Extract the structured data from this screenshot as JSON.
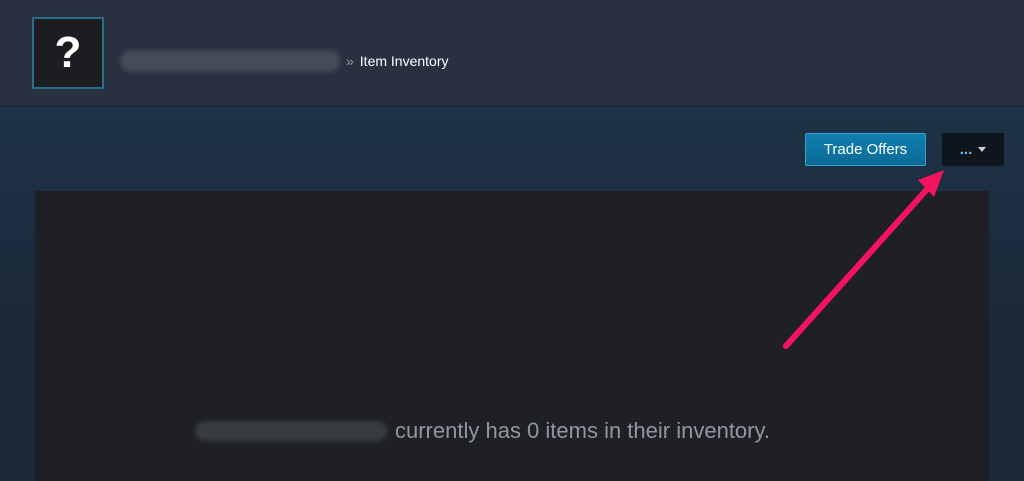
{
  "header": {
    "avatar_glyph": "?",
    "breadcrumb_separator": "»",
    "page_title": "Item Inventory"
  },
  "actions": {
    "trade_offers_label": "Trade Offers",
    "more_label": "..."
  },
  "inventory": {
    "empty_message": "currently has 0 items in their inventory."
  },
  "annotation": {
    "arrow_color": "#f5135f"
  },
  "colors": {
    "page_background": "#1b2838",
    "header_background": "#27313f",
    "panel_background": "#1e2025",
    "button_accent": "#0f7fb0",
    "link_blue": "#66c0f4"
  }
}
